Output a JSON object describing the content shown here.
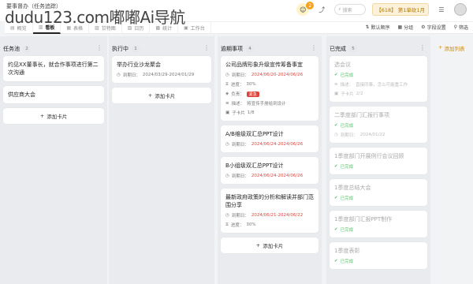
{
  "header": {
    "title": "要事督办（任务追踪）",
    "watermark": "dudu123.com嘟嘟Ai导航",
    "search_placeholder": "搜索",
    "vip_label": "【618】 第1单砍1月",
    "badge": "2"
  },
  "tabs": [
    {
      "icon": "▤",
      "label": "概览"
    },
    {
      "icon": "▥",
      "label": "看板"
    },
    {
      "icon": "▦",
      "label": "表格"
    },
    {
      "icon": "▨",
      "label": "甘特图"
    },
    {
      "icon": "▧",
      "label": "日历"
    },
    {
      "icon": "▩",
      "label": "统计"
    },
    {
      "icon": "▣",
      "label": "工作台"
    }
  ],
  "tools": {
    "sort": "默认顺序",
    "group": "分组",
    "view": "字段设置",
    "filter": "筛选"
  },
  "columns": [
    {
      "title": "任务池",
      "count": "2",
      "cards": [
        {
          "title": "约见XX董事长，就合作事项进行第二次沟通"
        },
        {
          "title": "供应商大会"
        }
      ],
      "add": "添加卡片"
    },
    {
      "title": "执行中",
      "count": "1",
      "cards": [
        {
          "title": "举办行业沙龙聚会",
          "date_label": "到期日：",
          "date": "2024/03/29-2024/01/29"
        }
      ],
      "add": "添加卡片"
    },
    {
      "title": "逾期事项",
      "count": "4",
      "cards": [
        {
          "title": "公司品牌形象升级宣传筹备事宜",
          "date_label": "到期日：",
          "date": "2024/06/20-2024/06/26",
          "progress_label": "进度：",
          "progress": "30%",
          "owner_label": "负责：",
          "owner_tag": "紧急",
          "remark_label": "描述：",
          "remark": "将宣传手册给到设计",
          "sub_label": "子卡片",
          "sub": "1/8"
        },
        {
          "title": "A/B维级双汇总PPT设计",
          "date_label": "到期日：",
          "date": "2024/06/24-2024/06/26"
        },
        {
          "title": "B小组级双汇总PPT设计",
          "date_label": "到期日：",
          "date": "2024/06/24-2024/06/26"
        },
        {
          "title": "最新政府政策的分析和解读并部门范围分享",
          "date_label": "到期日：",
          "date": "2024/06/21-2024/06/22",
          "progress_label": "进度：",
          "progress": "30%"
        }
      ],
      "add": "添加卡片"
    },
    {
      "title": "已完成",
      "count": "5",
      "cards": [
        {
          "title": "选会议",
          "status": "已完成",
          "remark_label": "描述：",
          "remark": "直接同事，怎么可能重工作",
          "sub_label": "子卡片",
          "sub": "2/2"
        },
        {
          "title": "二季度部门汇报行事项",
          "status": "已完成",
          "date_label": "到期日：",
          "date": "2024/01/22"
        },
        {
          "title": "1季度部门开展例行会议回顾",
          "status": "已完成"
        },
        {
          "title": "1季度总结大会",
          "status": "已完成"
        },
        {
          "title": "1季度部门汇报PPT制作",
          "status": "已完成"
        },
        {
          "title": "1季度表彰",
          "status": "已完成"
        }
      ]
    }
  ],
  "add_list": "添加列表"
}
